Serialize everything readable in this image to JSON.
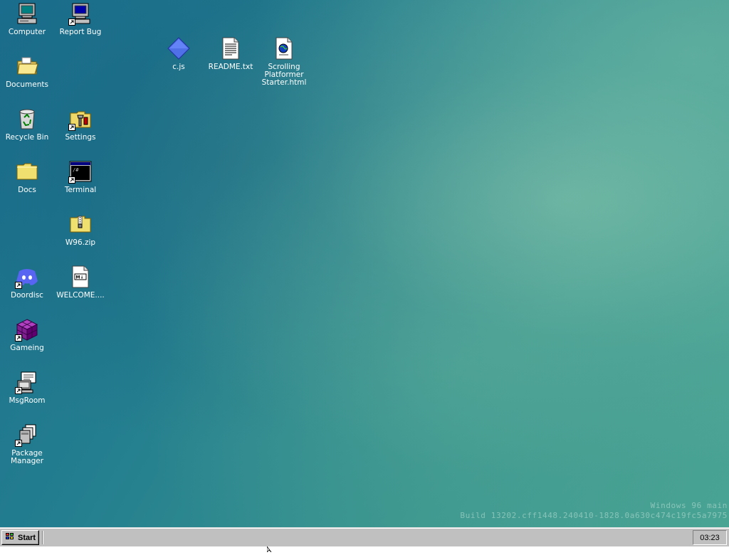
{
  "desktop": {
    "icons": {
      "computer": "Computer",
      "report_bug": "Report Bug",
      "documents": "Documents",
      "recycle_bin": "Recycle Bin",
      "settings": "Settings",
      "docs": "Docs",
      "terminal": "Terminal",
      "w96zip": "W96.zip",
      "doordisc": "Doordisc",
      "welcome": "WELCOME....",
      "gameing": "Gameing",
      "msgroom": "MsgRoom",
      "package_manager": "Package Manager",
      "cjs": "c.js",
      "readme": "README.txt",
      "scrolling": "Scrolling Platformer Starter.html"
    }
  },
  "build_info": {
    "line1": "Windows 96 main",
    "line2": "Build 13202.cff1448.240410-1828.0a630c474c19fc5a7975"
  },
  "taskbar": {
    "start_label": "Start",
    "clock": "03:23"
  },
  "colors": {
    "taskbar": "#c0c0c0",
    "desktop_teal": "#237e8f"
  }
}
